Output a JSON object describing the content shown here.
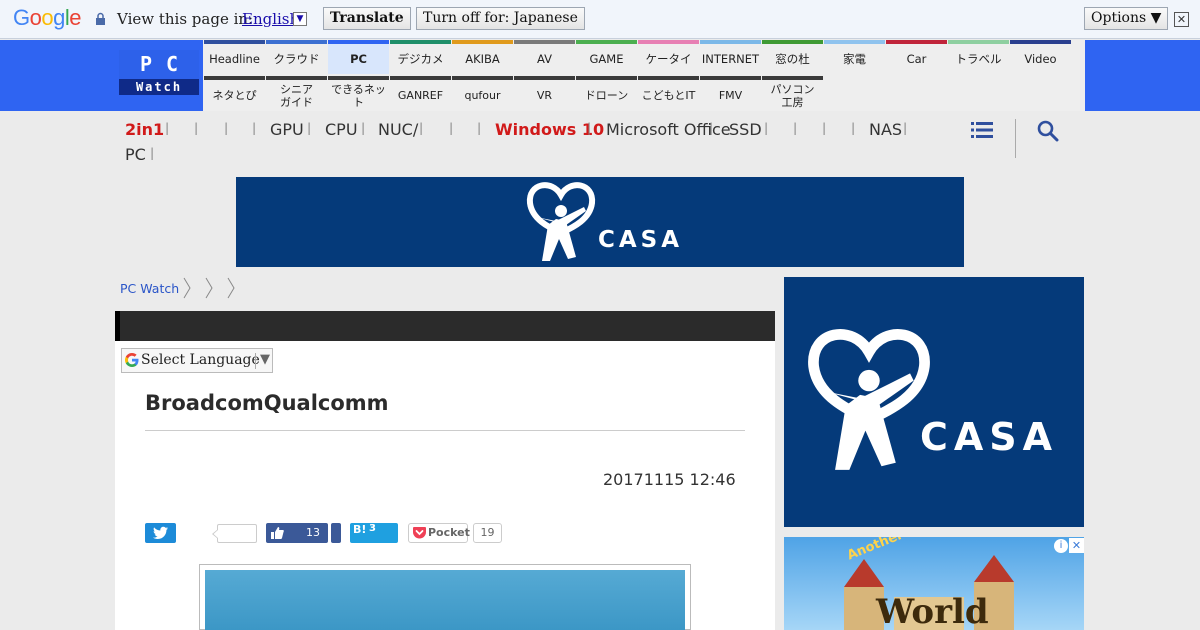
{
  "translate_bar": {
    "logo_text": "Google",
    "view_text": "View this page in:",
    "language": "English",
    "translate_button": "Translate",
    "turn_off_button": "Turn off for: Japanese",
    "options_button": "Options ▼",
    "close_glyph": "✕"
  },
  "site": {
    "logo_top": "PC",
    "logo_bottom": "Watch"
  },
  "nav": {
    "row1": [
      {
        "label": "Headline",
        "color": "#2f4f9e"
      },
      {
        "label": "クラウド",
        "color": "#3c6fd1"
      },
      {
        "label": "PC",
        "color": "#2f64f2",
        "active": true
      },
      {
        "label": "デジカメ",
        "color": "#1f8f6a"
      },
      {
        "label": "AKIBA",
        "color": "#e09a1c"
      },
      {
        "label": "AV",
        "color": "#7a7a7a"
      },
      {
        "label": "GAME",
        "color": "#4caf50"
      },
      {
        "label": "ケータイ",
        "color": "#e77fb3"
      },
      {
        "label": "INTERNET",
        "color": "#7bb8e8"
      },
      {
        "label": "窓の杜",
        "color": "#3f9a34"
      },
      {
        "label": "家電",
        "color": "#8fc3ee"
      },
      {
        "label": "Car",
        "color": "#c0243a"
      },
      {
        "label": "トラベル",
        "color": "#8ecfa0"
      },
      {
        "label": "Video",
        "color": "#2a3f8f"
      }
    ],
    "row2": [
      {
        "label": "ネタとぴ"
      },
      {
        "label": "シニア\nガイド"
      },
      {
        "label": "できるネット"
      },
      {
        "label": "GANREF"
      },
      {
        "label": "qufour"
      },
      {
        "label": "VR"
      },
      {
        "label": "ドローン"
      },
      {
        "label": "こどもとIT"
      },
      {
        "label": "FMV"
      },
      {
        "label": "パソコン\n工房"
      }
    ]
  },
  "subnav": {
    "items": [
      "2in1",
      "GPU",
      "CPU",
      "NUC/",
      "Windows 10",
      "Microsoft Office",
      "SSD",
      "NAS",
      "PC"
    ],
    "separator": "|"
  },
  "ads": {
    "brand": "CASA",
    "side2_text": "Another Life Adventure",
    "side2_title": "World"
  },
  "breadcrumb": {
    "home": "PC Watch"
  },
  "translate_widget": {
    "label": "Select Language",
    "arrow": "▼"
  },
  "article": {
    "title": "BroadcomQualcomm",
    "date": "20171115 12:46"
  },
  "social": {
    "fb_count": "13",
    "hatena_label": "B!",
    "hatena_count": "3",
    "pocket_label": "Pocket",
    "pocket_count": "19"
  }
}
